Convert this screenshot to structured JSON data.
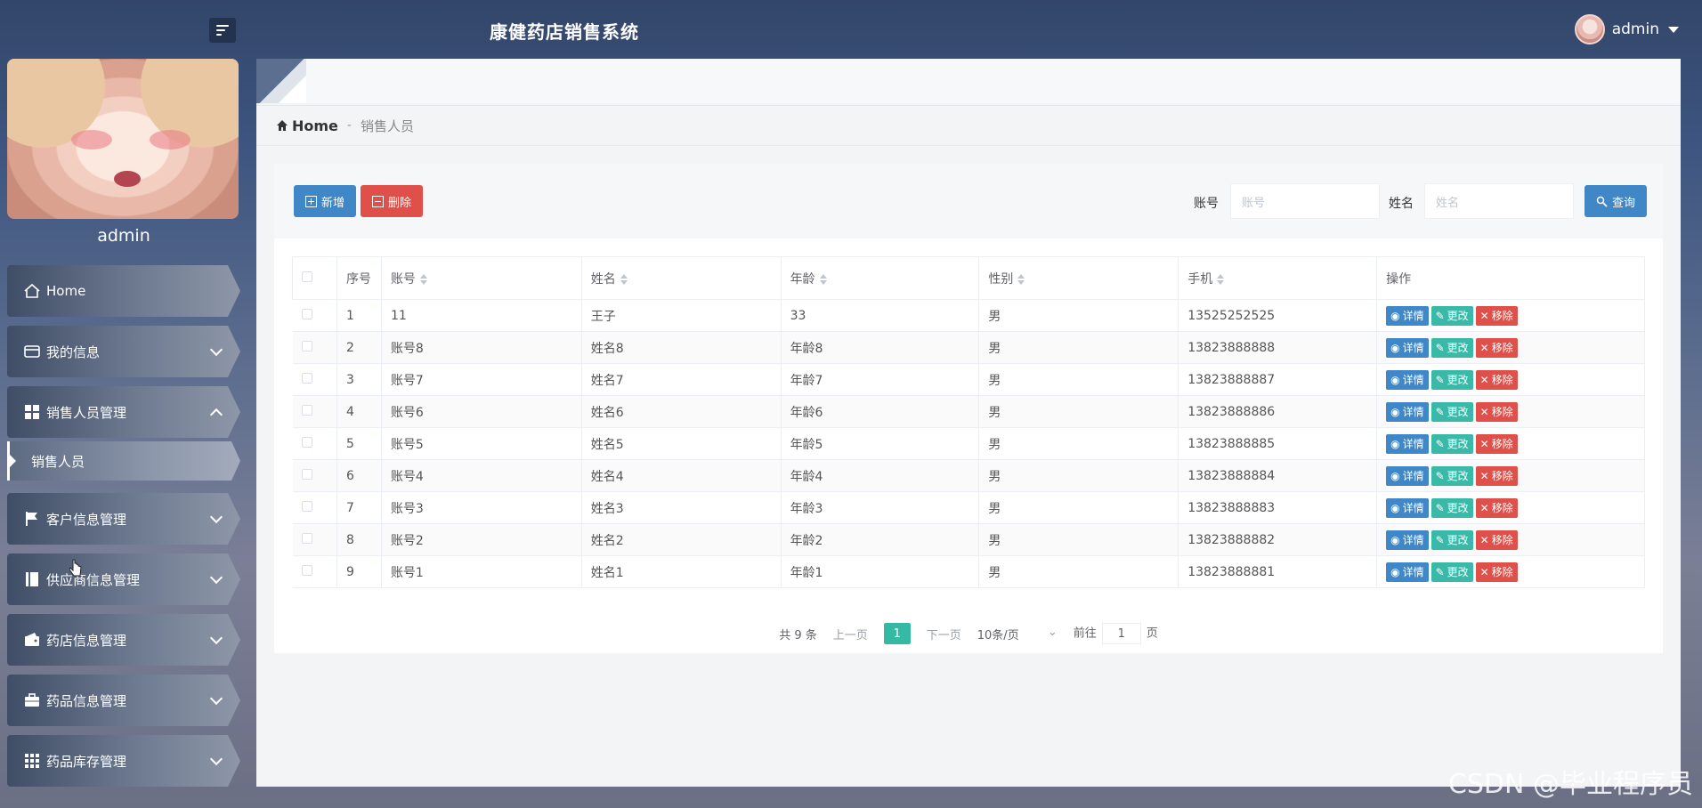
{
  "app": {
    "title": "康健药店销售系统"
  },
  "user": {
    "name": "admin"
  },
  "sidebar": {
    "profile_name": "admin",
    "items": [
      {
        "label": "Home",
        "icon": "home-icon"
      },
      {
        "label": "我的信息",
        "icon": "card-icon"
      },
      {
        "label": "销售人员管理",
        "icon": "grid-icon",
        "expanded": true,
        "sub": [
          {
            "label": "销售人员"
          }
        ]
      },
      {
        "label": "客户信息管理",
        "icon": "flag-icon"
      },
      {
        "label": "供应商信息管理",
        "icon": "book-icon"
      },
      {
        "label": "药店信息管理",
        "icon": "wallet-icon"
      },
      {
        "label": "药品信息管理",
        "icon": "briefcase-icon"
      },
      {
        "label": "药品库存管理",
        "icon": "apps-icon"
      }
    ]
  },
  "breadcrumb": {
    "home": "Home",
    "current": "销售人员"
  },
  "toolbar": {
    "add_label": "新增",
    "delete_label": "删除",
    "search_label": "查询",
    "account_label": "账号",
    "account_placeholder": "账号",
    "name_label": "姓名",
    "name_placeholder": "姓名"
  },
  "table": {
    "headers": [
      "序号",
      "账号",
      "姓名",
      "年龄",
      "性别",
      "手机",
      "操作"
    ],
    "actions": {
      "view": "详情",
      "edit": "更改",
      "remove": "移除"
    },
    "rows": [
      [
        "1",
        "11",
        "王子",
        "33",
        "男",
        "13525252525"
      ],
      [
        "2",
        "账号8",
        "姓名8",
        "年龄8",
        "男",
        "13823888888"
      ],
      [
        "3",
        "账号7",
        "姓名7",
        "年龄7",
        "男",
        "13823888887"
      ],
      [
        "4",
        "账号6",
        "姓名6",
        "年龄6",
        "男",
        "13823888886"
      ],
      [
        "5",
        "账号5",
        "姓名5",
        "年龄5",
        "男",
        "13823888885"
      ],
      [
        "6",
        "账号4",
        "姓名4",
        "年龄4",
        "男",
        "13823888884"
      ],
      [
        "7",
        "账号3",
        "姓名3",
        "年龄3",
        "男",
        "13823888883"
      ],
      [
        "8",
        "账号2",
        "姓名2",
        "年龄2",
        "男",
        "13823888882"
      ],
      [
        "9",
        "账号1",
        "姓名1",
        "年龄1",
        "男",
        "13823888881"
      ]
    ]
  },
  "pager": {
    "total": "共 9 条",
    "prev": "上一页",
    "current": "1",
    "next": "下一页",
    "size": "10条/页",
    "goto_prefix": "前往",
    "goto_value": "1",
    "goto_suffix": "页"
  },
  "watermark": "CSDN @毕业程序员",
  "colors": {
    "primary": "#3f87c7",
    "danger": "#e0504a",
    "success": "#3bb9a8",
    "pager_active": "#34b9a3"
  }
}
